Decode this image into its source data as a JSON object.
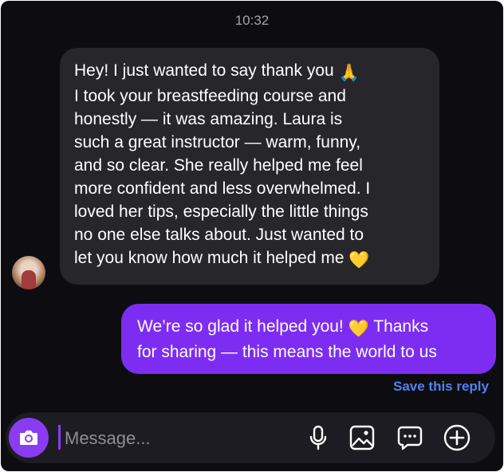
{
  "timestamp": "10:32",
  "incoming_message": {
    "lines": [
      "Hey! I just wanted to say thank you",
      "I took your breastfeeding course and",
      "honestly — it was amazing. Laura is",
      "such a great instructor — warm, funny,",
      "and so clear. She really helped me feel",
      "more confident and less overwhelmed. I",
      "loved her tips, especially the little things",
      "no one else talks about. Just wanted to",
      "let you know how much it helped me"
    ],
    "emoji_1": "🙏",
    "emoji_2": "💛"
  },
  "outgoing_message": {
    "line_1_text": "We’re so glad it helped you!",
    "line_1_emoji": "💛",
    "line_1_tail": "Thanks",
    "line_2": "for sharing — this means the world to us"
  },
  "save_reply_label": "Save this reply",
  "composer": {
    "placeholder": "Message...",
    "icons": [
      "camera-icon",
      "microphone-icon",
      "image-icon",
      "sticker-chat-icon",
      "add-circle-icon"
    ]
  },
  "colors": {
    "background": "#0d0c11",
    "incoming_bubble": "#26262b",
    "outgoing_bubble": "#7d2df1",
    "accent": "#8a3cf2",
    "link": "#4f82f0"
  }
}
